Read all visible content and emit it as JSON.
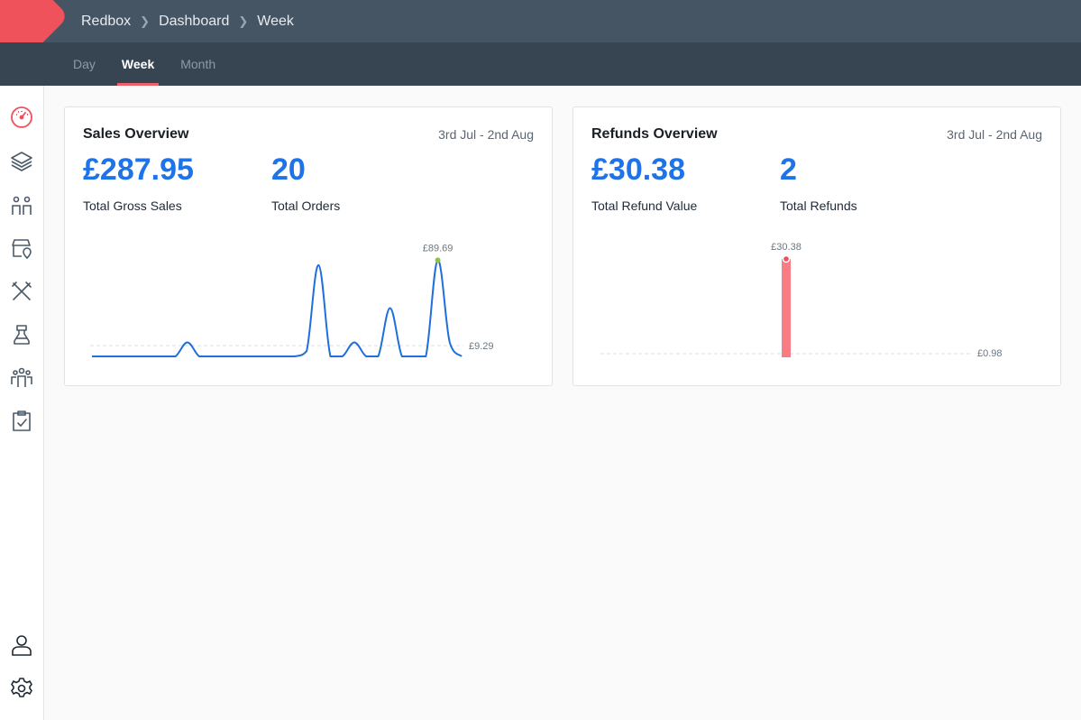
{
  "breadcrumb": [
    "Redbox",
    "Dashboard",
    "Week"
  ],
  "tabs": [
    {
      "label": "Day",
      "active": false
    },
    {
      "label": "Week",
      "active": true
    },
    {
      "label": "Month",
      "active": false
    }
  ],
  "sidebar": {
    "icons": [
      "dashboard-gauge-icon",
      "layers-icon",
      "people-icon",
      "store-location-icon",
      "utensils-icon",
      "chef-icon",
      "team-icon",
      "clipboard-check-icon"
    ],
    "bottom_icons": [
      "user-icon",
      "settings-gear-icon"
    ]
  },
  "colors": {
    "accent": "#f0525c",
    "primary": "#1e73e8",
    "header": "#465563",
    "subheader": "#374552"
  },
  "sales": {
    "title": "Sales Overview",
    "range": "3rd Jul - 2nd Aug",
    "gross_value": "£287.95",
    "gross_label": "Total Gross Sales",
    "orders_value": "20",
    "orders_label": "Total Orders",
    "peak_label": "£89.69",
    "avg_label": "£9.29"
  },
  "refunds": {
    "title": "Refunds Overview",
    "range": "3rd Jul - 2nd Aug",
    "value": "£30.38",
    "value_label": "Total Refund Value",
    "count": "2",
    "count_label": "Total Refunds",
    "peak_label": "£30.38",
    "avg_label": "£0.98"
  },
  "chart_data": [
    {
      "type": "line",
      "x": [
        1,
        2,
        3,
        4,
        5,
        6,
        7,
        8,
        9,
        10,
        11,
        12,
        13,
        14,
        15,
        16,
        17,
        18,
        19,
        20,
        21,
        22,
        23,
        24,
        25,
        26,
        27,
        28,
        29,
        30,
        31
      ],
      "values": [
        0,
        0,
        0,
        0,
        0,
        0,
        0,
        0,
        13,
        0,
        0,
        0,
        0,
        0,
        0,
        0,
        0,
        0,
        5,
        85,
        0,
        0,
        13,
        0,
        0,
        45,
        0,
        0,
        0,
        89.69,
        13,
        0
      ],
      "average": 9.29,
      "ylim": [
        0,
        90
      ]
    },
    {
      "type": "bar",
      "x": [
        1,
        2,
        3,
        4,
        5,
        6,
        7,
        8,
        9,
        10,
        11,
        12,
        13,
        14,
        15,
        16,
        17,
        18,
        19,
        20,
        21,
        22,
        23,
        24,
        25,
        26,
        27,
        28,
        29,
        30,
        31
      ],
      "values": [
        0,
        0,
        0,
        0,
        0,
        0,
        0,
        0,
        0,
        0,
        0,
        0,
        0,
        0,
        0,
        30.38,
        0,
        0,
        0,
        0,
        0,
        0,
        0,
        0,
        0,
        0,
        0,
        0,
        0,
        0,
        0
      ],
      "average": 0.98,
      "ylim": [
        0,
        30.38
      ]
    }
  ]
}
